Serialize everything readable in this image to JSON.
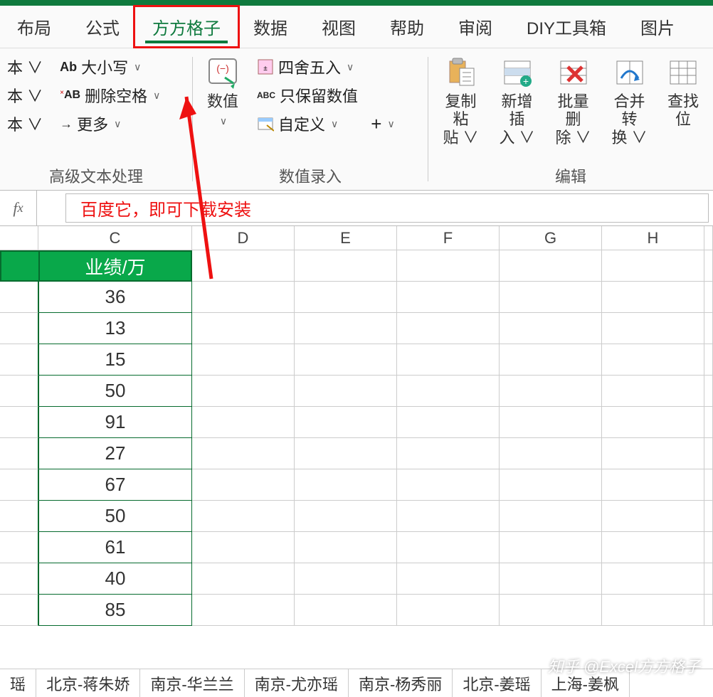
{
  "tabs": {
    "layout": "布局",
    "formula": "公式",
    "ffgz": "方方格子",
    "data": "数据",
    "view": "视图",
    "help": "帮助",
    "review": "审阅",
    "diy": "DIY工具箱",
    "image": "图片"
  },
  "ribbon": {
    "text_group": {
      "title": "高级文本处理",
      "items": {
        "ben1": "本 ∨",
        "ben2": "本 ∨",
        "ben3": "本 ∨",
        "case": "大小写",
        "delspace": "删除空格",
        "more": "更多"
      }
    },
    "num_group": {
      "title": "数值录入",
      "shuzhi": "数值",
      "round": "四舍五入",
      "keepnum": "只保留数值",
      "custom": "自定义",
      "plus": "+"
    },
    "edit_group": {
      "title": "编辑",
      "copy": "复制粘",
      "copy2": "贴 ∨",
      "insert": "新增插",
      "insert2": "入 ∨",
      "batchdel": "批量删",
      "batchdel2": "除 ∨",
      "merge": "合并转",
      "merge2": "换 ∨",
      "find": "查找",
      "find2": "位"
    }
  },
  "fx_text": "百度它，即可下载安装",
  "columns": [
    "C",
    "D",
    "E",
    "F",
    "G",
    "H"
  ],
  "header_c": "业绩/万",
  "data_c": [
    "36",
    "13",
    "15",
    "50",
    "91",
    "27",
    "67",
    "50",
    "61",
    "40",
    "85"
  ],
  "sheet_tabs": [
    "瑶",
    "北京-蒋朱娇",
    "南京-华兰兰",
    "南京-尤亦瑶",
    "南京-杨秀丽",
    "北京-姜瑶",
    "上海-姜枫"
  ],
  "watermark": "知乎 @Excel方方格子",
  "icons": {
    "ab": "Ab",
    "xab": "AB"
  }
}
